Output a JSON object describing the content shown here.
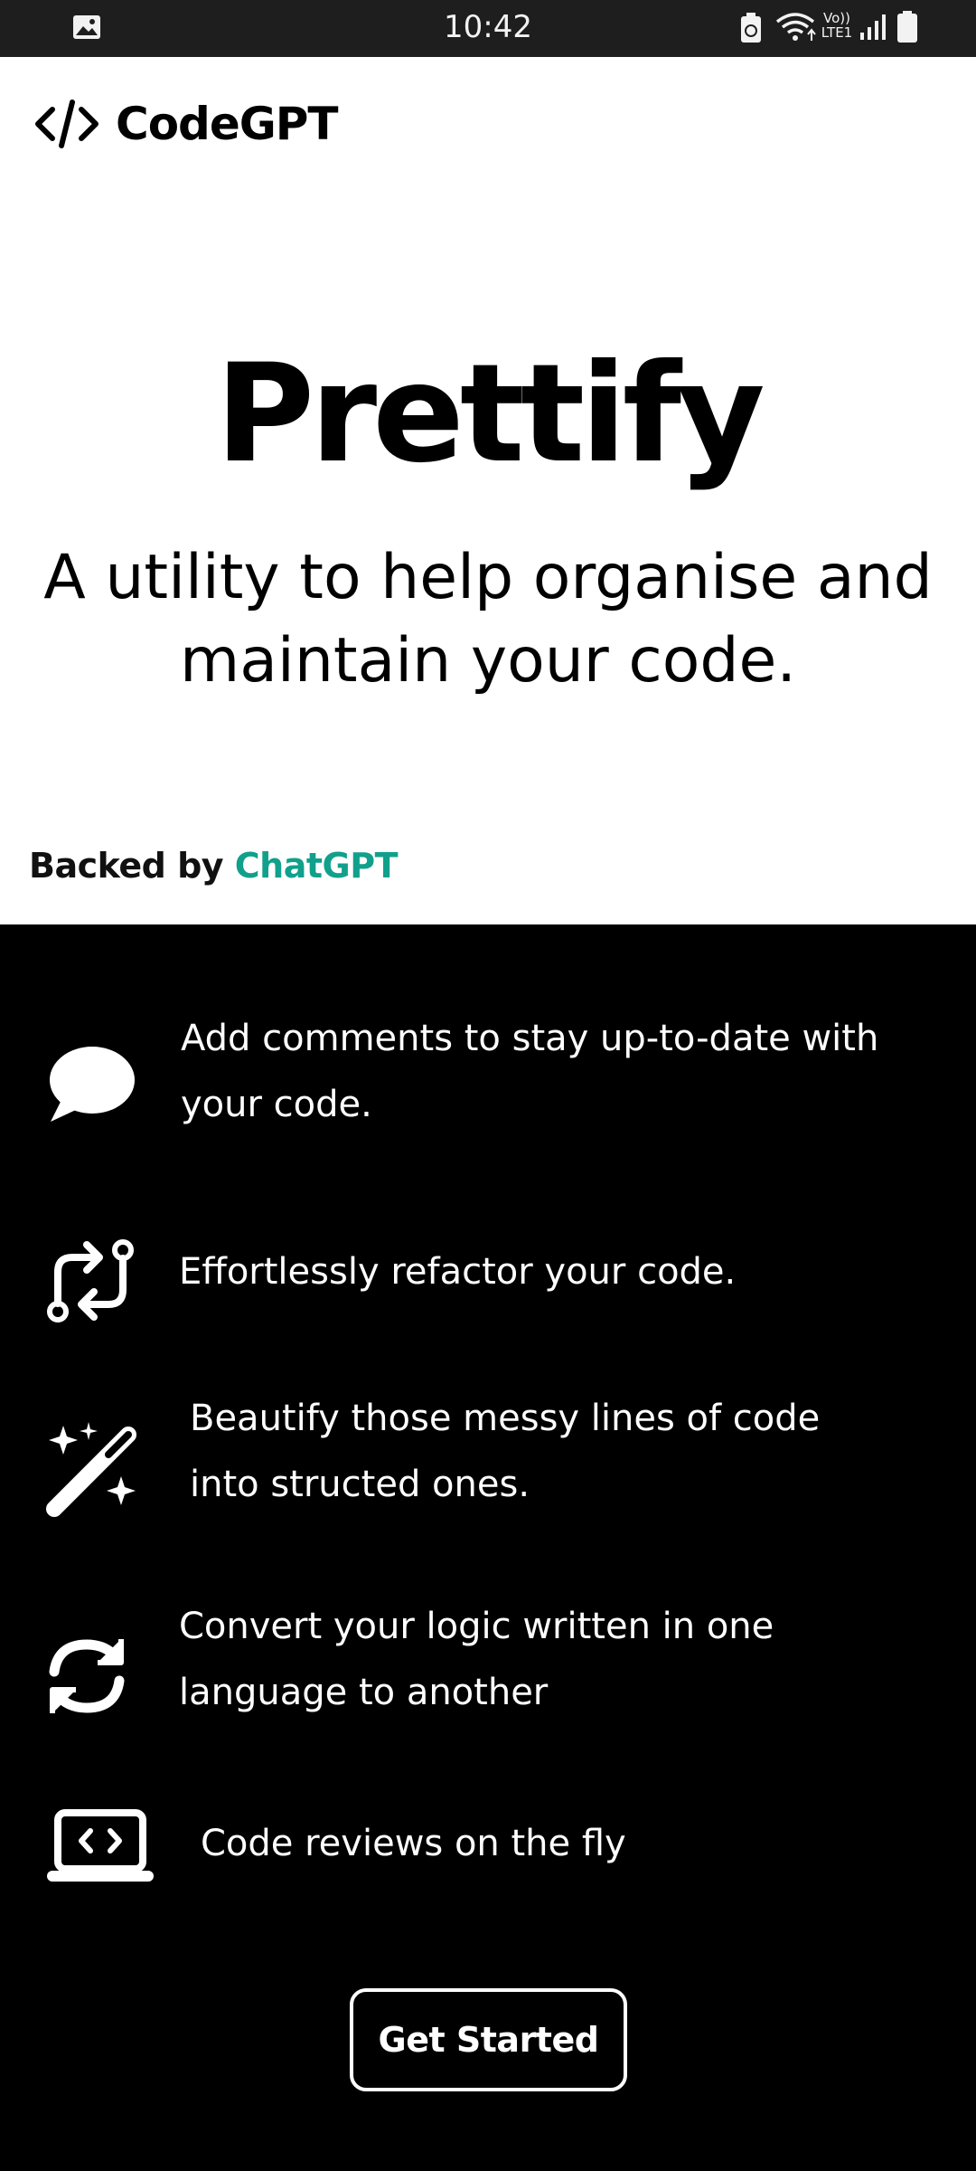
{
  "status_bar": {
    "time": "10:42",
    "network_label_top": "Vo))",
    "network_label_bottom": "LTE1",
    "icons": [
      "gallery-icon",
      "battery-saver-icon",
      "wifi-icon",
      "signal-icon",
      "battery-icon"
    ]
  },
  "brand": {
    "name": "CodeGPT",
    "icon": "code-brackets-icon"
  },
  "hero": {
    "title": "Prettify",
    "subtitle_line1": "A utility to help organise and",
    "subtitle_line2": "maintain your code.",
    "backed_prefix": "Backed by ",
    "backed_accent": "ChatGPT",
    "accent_color": "#10a08b"
  },
  "features": [
    {
      "icon": "speech-bubble-icon",
      "line1": "Add comments to stay up-to-date with",
      "line2": "your code."
    },
    {
      "icon": "refactor-arrows-icon",
      "line1": "Effortlessly refactor your code.",
      "line2": ""
    },
    {
      "icon": "magic-wand-icon",
      "line1": "Beautify those messy lines of code",
      "line2": "into structed ones."
    },
    {
      "icon": "convert-arrows-icon",
      "line1": "Convert your logic written in one",
      "line2": "language to another"
    },
    {
      "icon": "laptop-code-icon",
      "line1": "Code reviews on the fly",
      "line2": ""
    }
  ],
  "cta": {
    "label": "Get Started"
  }
}
